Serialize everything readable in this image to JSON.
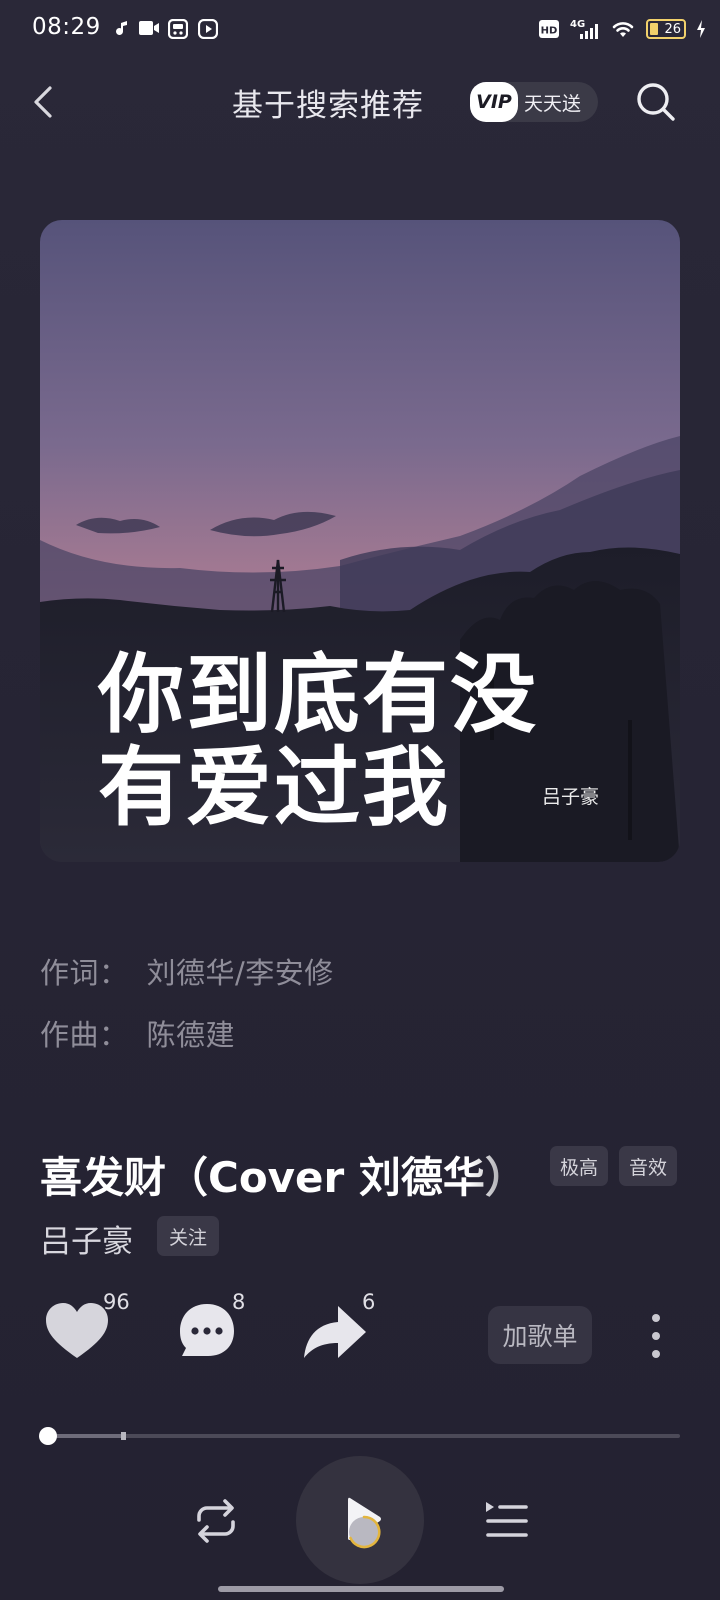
{
  "status_bar": {
    "time": "08:29",
    "hd_label": "HD",
    "network_label": "4G",
    "battery_level": "26"
  },
  "header": {
    "title": "基于搜索推荐",
    "vip_badge": "VIP",
    "vip_text": "天天送"
  },
  "cover": {
    "line1": "你到底有没",
    "line2": "有爱过我",
    "artist_mark": "吕子豪"
  },
  "credits": [
    {
      "label": "作词：",
      "value": "刘德华/李安修"
    },
    {
      "label": "作曲：",
      "value": "陈德建"
    }
  ],
  "song": {
    "title": "喜发财（Cover 刘德华）",
    "tags": [
      "极高",
      "音效"
    ],
    "artist": "吕子豪",
    "follow_label": "关注"
  },
  "actions": {
    "like_count": "96",
    "comment_count": "8",
    "share_count": "6",
    "add_playlist_label": "加歌单"
  },
  "playback": {
    "progress": 0.0,
    "buffered": 0.12
  },
  "colors": {
    "background": "#272534",
    "accent_battery": "#f2d16b",
    "loading_ring": "#e3b53e"
  }
}
